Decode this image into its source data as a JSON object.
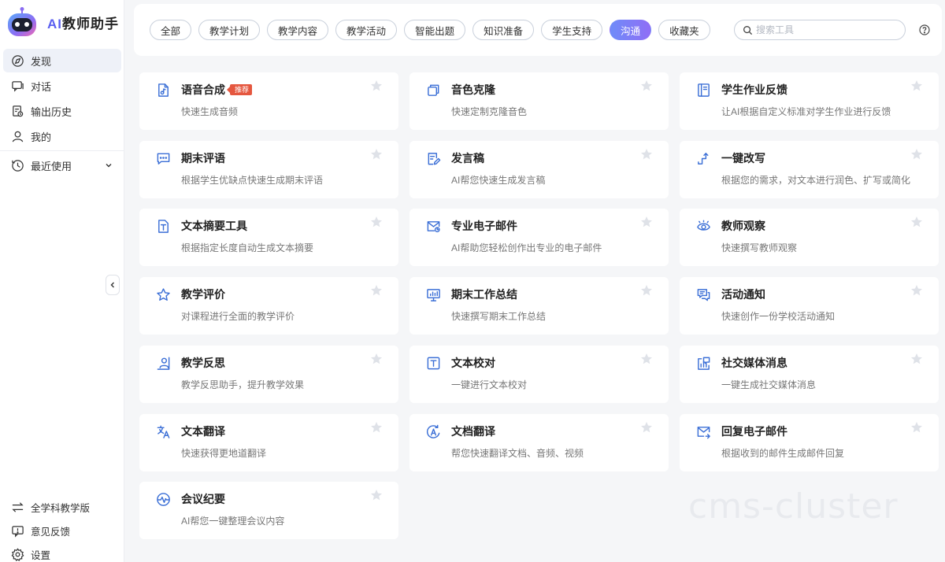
{
  "app": {
    "logo_prefix": "AI",
    "logo_name": "教师助手"
  },
  "sidebar": {
    "items": [
      {
        "label": "发现",
        "icon": "compass-icon"
      },
      {
        "label": "对话",
        "icon": "chat-icon"
      },
      {
        "label": "输出历史",
        "icon": "history-doc-icon"
      },
      {
        "label": "我的",
        "icon": "user-icon"
      }
    ],
    "recent": {
      "label": "最近使用",
      "icon": "clock-icon"
    },
    "bottom": [
      {
        "label": "全学科教学版",
        "icon": "switch-icon"
      },
      {
        "label": "意见反馈",
        "icon": "feedback-icon"
      },
      {
        "label": "设置",
        "icon": "gear-icon"
      }
    ]
  },
  "tabs": [
    "全部",
    "教学计划",
    "教学内容",
    "教学活动",
    "智能出题",
    "知识准备",
    "学生支持",
    "沟通",
    "收藏夹"
  ],
  "active_tab": "沟通",
  "search": {
    "placeholder": "搜索工具"
  },
  "cards": [
    {
      "title": "语音合成",
      "desc": "快速生成音频",
      "badge": "推荐",
      "icon": "audio-file-icon"
    },
    {
      "title": "音色克隆",
      "desc": "快速定制克隆音色",
      "icon": "clone-icon"
    },
    {
      "title": "学生作业反馈",
      "desc": "让AI根据自定义标准对学生作业进行反馈",
      "icon": "homework-doc-icon"
    },
    {
      "title": "期末评语",
      "desc": "根据学生优缺点快速生成期末评语",
      "icon": "comment-icon"
    },
    {
      "title": "发言稿",
      "desc": "AI帮您快速生成发言稿",
      "icon": "edit-doc-icon"
    },
    {
      "title": "一键改写",
      "desc": "根据您的需求，对文本进行润色、扩写或简化",
      "icon": "rewrite-arrows-icon"
    },
    {
      "title": "文本摘要工具",
      "desc": "根据指定长度自动生成文本摘要",
      "icon": "text-doc-icon"
    },
    {
      "title": "专业电子邮件",
      "desc": "AI帮助您轻松创作出专业的电子邮件",
      "icon": "email-icon"
    },
    {
      "title": "教师观察",
      "desc": "快速撰写教师观察",
      "icon": "eye-icon"
    },
    {
      "title": "教学评价",
      "desc": "对课程进行全面的教学评价",
      "icon": "star-outline-icon"
    },
    {
      "title": "期末工作总结",
      "desc": "快速撰写期末工作总结",
      "icon": "monitor-chart-icon"
    },
    {
      "title": "活动通知",
      "desc": "快速创作一份学校活动通知",
      "icon": "notice-chat-icon"
    },
    {
      "title": "教学反思",
      "desc": "教学反思助手，提升教学效果",
      "icon": "reflection-person-icon"
    },
    {
      "title": "文本校对",
      "desc": "一键进行文本校对",
      "icon": "text-box-icon"
    },
    {
      "title": "社交媒体消息",
      "desc": "一键生成社交媒体消息",
      "icon": "social-chart-icon"
    },
    {
      "title": "文本翻译",
      "desc": "快速获得更地道翻译",
      "icon": "translate-icon"
    },
    {
      "title": "文档翻译",
      "desc": "帮您快速翻译文档、音频、视频",
      "icon": "doc-translate-icon"
    },
    {
      "title": "回复电子邮件",
      "desc": "根据收到的邮件生成邮件回复",
      "icon": "reply-email-icon"
    },
    {
      "title": "会议纪要",
      "desc": "AI帮您一键整理会议内容",
      "icon": "pulse-icon"
    }
  ],
  "watermark": "cms-cluster",
  "colors": {
    "accent": "#3b6fd6",
    "active_tab_start": "#6f8cf8",
    "active_tab_end": "#8f6ef6",
    "badge": "#e5573f"
  }
}
